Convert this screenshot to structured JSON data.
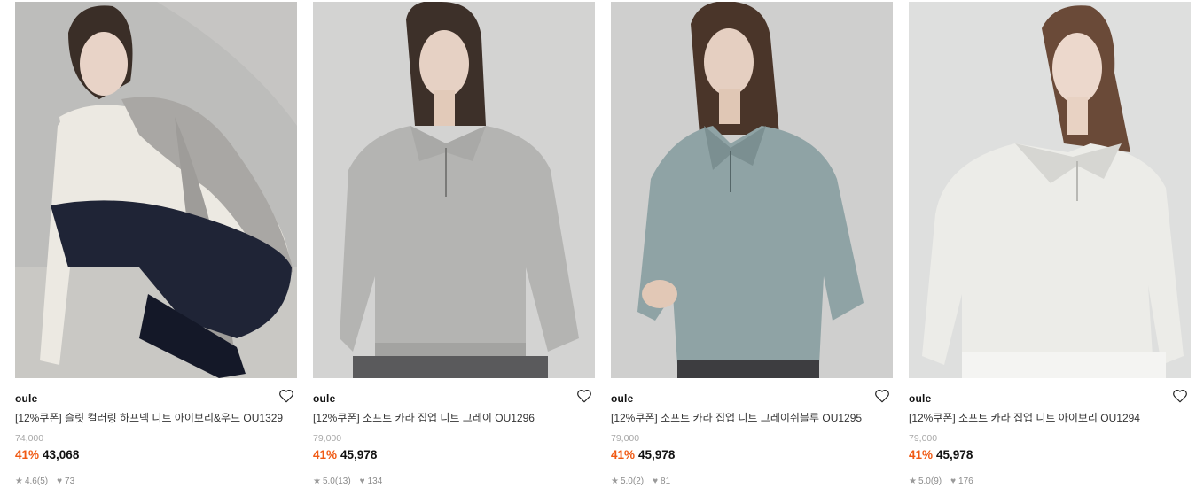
{
  "products": [
    {
      "brand": "oule",
      "title": "[12%쿠폰] 슬릿 컬러링 하프넥 니트 아이보리&우드 OU1329",
      "original_price": "74,000",
      "discount": "41%",
      "price": "43,068",
      "rating": "4.6",
      "reviews": "(5)",
      "likes": "73",
      "colors": {
        "background": "#bdbdbb",
        "garment": "#a9a7a4",
        "accent": "#ece9e2"
      }
    },
    {
      "brand": "oule",
      "title": "[12%쿠폰] 소프트 카라 집업 니트 그레이 OU1296",
      "original_price": "79,000",
      "discount": "41%",
      "price": "45,978",
      "rating": "5.0",
      "reviews": "(13)",
      "likes": "134",
      "colors": {
        "background": "#d3d3d2",
        "garment": "#b4b4b2",
        "accent": "#9f9f9d"
      }
    },
    {
      "brand": "oule",
      "title": "[12%쿠폰] 소프트 카라 집업 니트 그레이쉬블루 OU1295",
      "original_price": "79,000",
      "discount": "41%",
      "price": "45,978",
      "rating": "5.0",
      "reviews": "(2)",
      "likes": "81",
      "colors": {
        "background": "#cfcfce",
        "garment": "#8fa3a5",
        "accent": "#7b8f91"
      }
    },
    {
      "brand": "oule",
      "title": "[12%쿠폰] 소프트 카라 집업 니트 아이보리 OU1294",
      "original_price": "79,000",
      "discount": "41%",
      "price": "45,978",
      "rating": "5.0",
      "reviews": "(9)",
      "likes": "176",
      "colors": {
        "background": "#dedfde",
        "garment": "#ecece8",
        "accent": "#d6d6d2"
      }
    }
  ],
  "theme": {
    "discount_color": "#f05a14",
    "meta_color": "#8c8c8c"
  },
  "icons": {
    "wishlist": "heart-outline-icon",
    "rating": "star-icon",
    "likes": "heart-filled-icon"
  }
}
